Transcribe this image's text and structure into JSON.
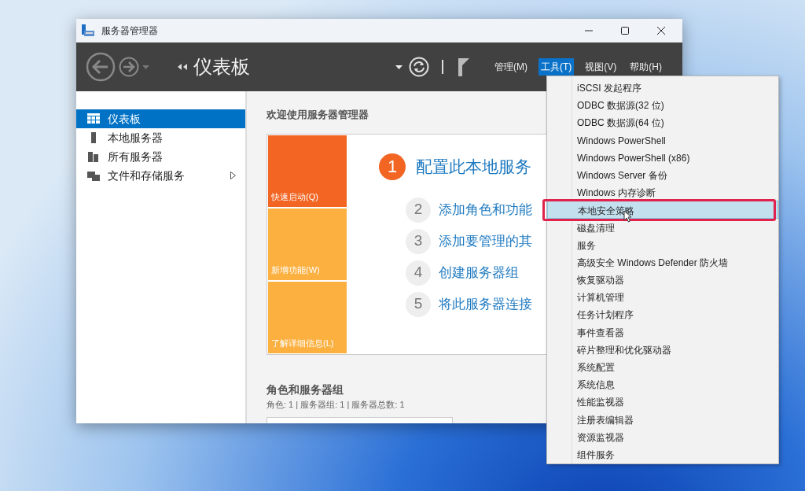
{
  "window": {
    "title": "服务器管理器"
  },
  "header": {
    "title": "仪表板",
    "menus": [
      {
        "label": "管理(M)",
        "selected": false
      },
      {
        "label": "工具(T)",
        "selected": true
      },
      {
        "label": "视图(V)",
        "selected": false
      },
      {
        "label": "帮助(H)",
        "selected": false
      }
    ]
  },
  "sidebar": {
    "items": [
      {
        "label": "仪表板",
        "selected": true,
        "expandable": false
      },
      {
        "label": "本地服务器",
        "selected": false,
        "expandable": false
      },
      {
        "label": "所有服务器",
        "selected": false,
        "expandable": false
      },
      {
        "label": "文件和存储服务",
        "selected": false,
        "expandable": true
      }
    ]
  },
  "welcome": {
    "title": "欢迎使用服务器管理器",
    "tiles": [
      {
        "label": "快速启动(Q)",
        "color": "#f26522"
      },
      {
        "label": "新增功能(W)",
        "color": "#fbb040"
      },
      {
        "label": "了解详细信息(L)",
        "color": "#fbb040"
      }
    ],
    "steps": [
      {
        "number": "1",
        "text": "配置此本地服务",
        "primary": true
      },
      {
        "number": "2",
        "text": "添加角色和功能",
        "primary": false
      },
      {
        "number": "3",
        "text": "添加要管理的其",
        "primary": false
      },
      {
        "number": "4",
        "text": "创建服务器组",
        "primary": false
      },
      {
        "number": "5",
        "text": "将此服务器连接",
        "primary": false
      }
    ]
  },
  "roles_section": {
    "title": "角色和服务器组",
    "summary": "角色: 1 | 服务器组: 1 | 服务器总数: 1"
  },
  "tools_menu": {
    "items": [
      {
        "label": "iSCSI 发起程序",
        "selected": false,
        "annotated": false
      },
      {
        "label": "ODBC 数据源(32 位)",
        "selected": false,
        "annotated": false
      },
      {
        "label": "ODBC 数据源(64 位)",
        "selected": false,
        "annotated": false
      },
      {
        "label": "Windows PowerShell",
        "selected": false,
        "annotated": false
      },
      {
        "label": "Windows PowerShell (x86)",
        "selected": false,
        "annotated": false
      },
      {
        "label": "Windows Server 备份",
        "selected": false,
        "annotated": false
      },
      {
        "label": "Windows 内存诊断",
        "selected": false,
        "annotated": false
      },
      {
        "label": "本地安全策略",
        "selected": true,
        "annotated": true
      },
      {
        "label": "磁盘清理",
        "selected": false,
        "annotated": false
      },
      {
        "label": "服务",
        "selected": false,
        "annotated": false
      },
      {
        "label": "高级安全 Windows Defender 防火墙",
        "selected": false,
        "annotated": false
      },
      {
        "label": "恢复驱动器",
        "selected": false,
        "annotated": false
      },
      {
        "label": "计算机管理",
        "selected": false,
        "annotated": false
      },
      {
        "label": "任务计划程序",
        "selected": false,
        "annotated": false
      },
      {
        "label": "事件查看器",
        "selected": false,
        "annotated": false
      },
      {
        "label": "碎片整理和优化驱动器",
        "selected": false,
        "annotated": false
      },
      {
        "label": "系统配置",
        "selected": false,
        "annotated": false
      },
      {
        "label": "系统信息",
        "selected": false,
        "annotated": false
      },
      {
        "label": "性能监视器",
        "selected": false,
        "annotated": false
      },
      {
        "label": "注册表编辑器",
        "selected": false,
        "annotated": false
      },
      {
        "label": "资源监视器",
        "selected": false,
        "annotated": false
      },
      {
        "label": "组件服务",
        "selected": false,
        "annotated": false
      }
    ]
  }
}
